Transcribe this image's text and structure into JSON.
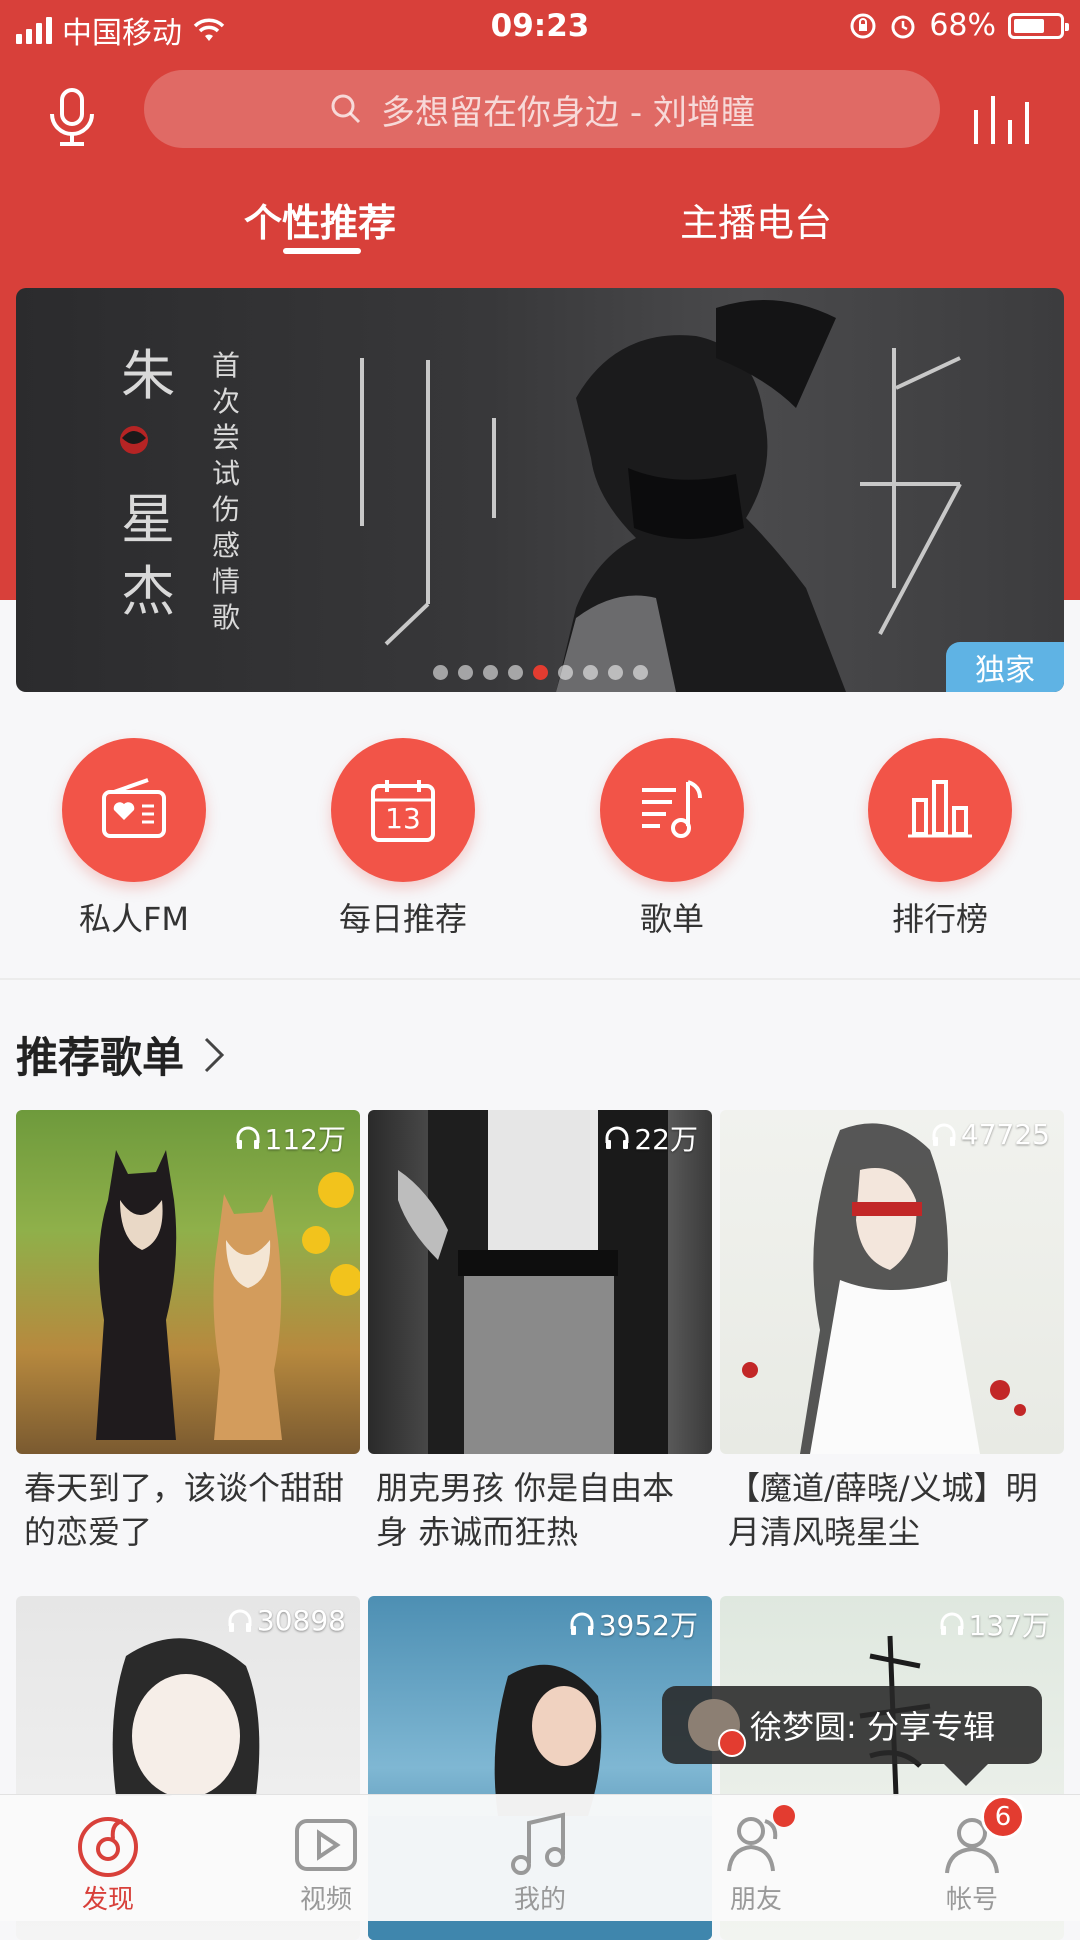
{
  "status_bar": {
    "carrier": "中国移动",
    "time": "09:23",
    "battery": "68%",
    "battery_level": 0.68
  },
  "search": {
    "placeholder": "多想留在你身边 - 刘增瞳"
  },
  "tabs": [
    {
      "label": "个性推荐",
      "active": true
    },
    {
      "label": "主播电台",
      "active": false
    }
  ],
  "banner": {
    "singer": [
      "朱",
      "星",
      "杰"
    ],
    "tagline": "首次尝试伤感情歌",
    "badge": "独家",
    "dot_count": 9,
    "active_dot": 4
  },
  "quick_actions": [
    {
      "label": "私人FM",
      "icon": "radio-icon"
    },
    {
      "label": "每日推荐",
      "icon": "calendar-icon",
      "day": "13"
    },
    {
      "label": "歌单",
      "icon": "playlist-icon"
    },
    {
      "label": "排行榜",
      "icon": "chart-icon"
    }
  ],
  "recommend": {
    "title": "推荐歌单",
    "playlists": [
      {
        "plays": "112万",
        "title": "春天到了，该谈个甜甜的恋爱了"
      },
      {
        "plays": "22万",
        "title": "朋克男孩 你是自由本身 赤诚而狂热"
      },
      {
        "plays": "47725",
        "title": "【魔道/薛晓/义城】明月清风晓星尘"
      },
      {
        "plays": "30898",
        "title": ""
      },
      {
        "plays": "3952万",
        "title": ""
      },
      {
        "plays": "137万",
        "title": ""
      }
    ]
  },
  "toast": {
    "user": "徐梦圆",
    "text": "徐梦圆: 分享专辑"
  },
  "bottom_nav": [
    {
      "label": "发现",
      "active": true
    },
    {
      "label": "视频",
      "active": false
    },
    {
      "label": "我的",
      "active": false
    },
    {
      "label": "朋友",
      "active": false,
      "dot": true
    },
    {
      "label": "帐号",
      "active": false,
      "badge": "6"
    }
  ],
  "colors": {
    "primary": "#d8403a",
    "accent": "#f25448",
    "exclusive": "#5fb3e4"
  }
}
